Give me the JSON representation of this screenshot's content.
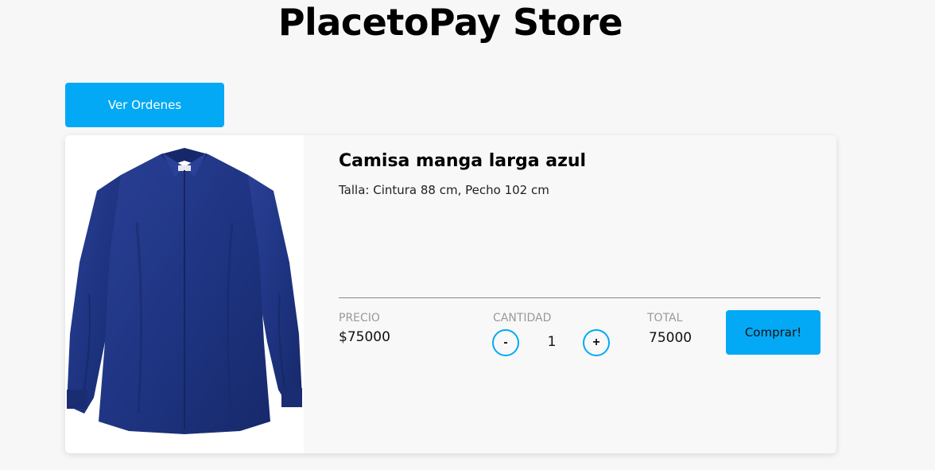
{
  "header": {
    "title": "PlacetoPay Store"
  },
  "toolbar": {
    "orders_label": "Ver Ordenes"
  },
  "product": {
    "name": "Camisa manga larga azul",
    "description": "Talla: Cintura 88 cm, Pecho 102 cm",
    "price_label": "PRECIO",
    "price_value": "$75000",
    "quantity_label": "CANTIDAD",
    "quantity_value": "1",
    "decrement_label": "-",
    "increment_label": "+",
    "total_label": "TOTAL",
    "total_value": "75000",
    "buy_label": "Comprar!",
    "image_icon": "shirt-image"
  },
  "colors": {
    "accent": "#03a9f4",
    "background": "#f7f7f7",
    "shirt": "#1f3583"
  }
}
